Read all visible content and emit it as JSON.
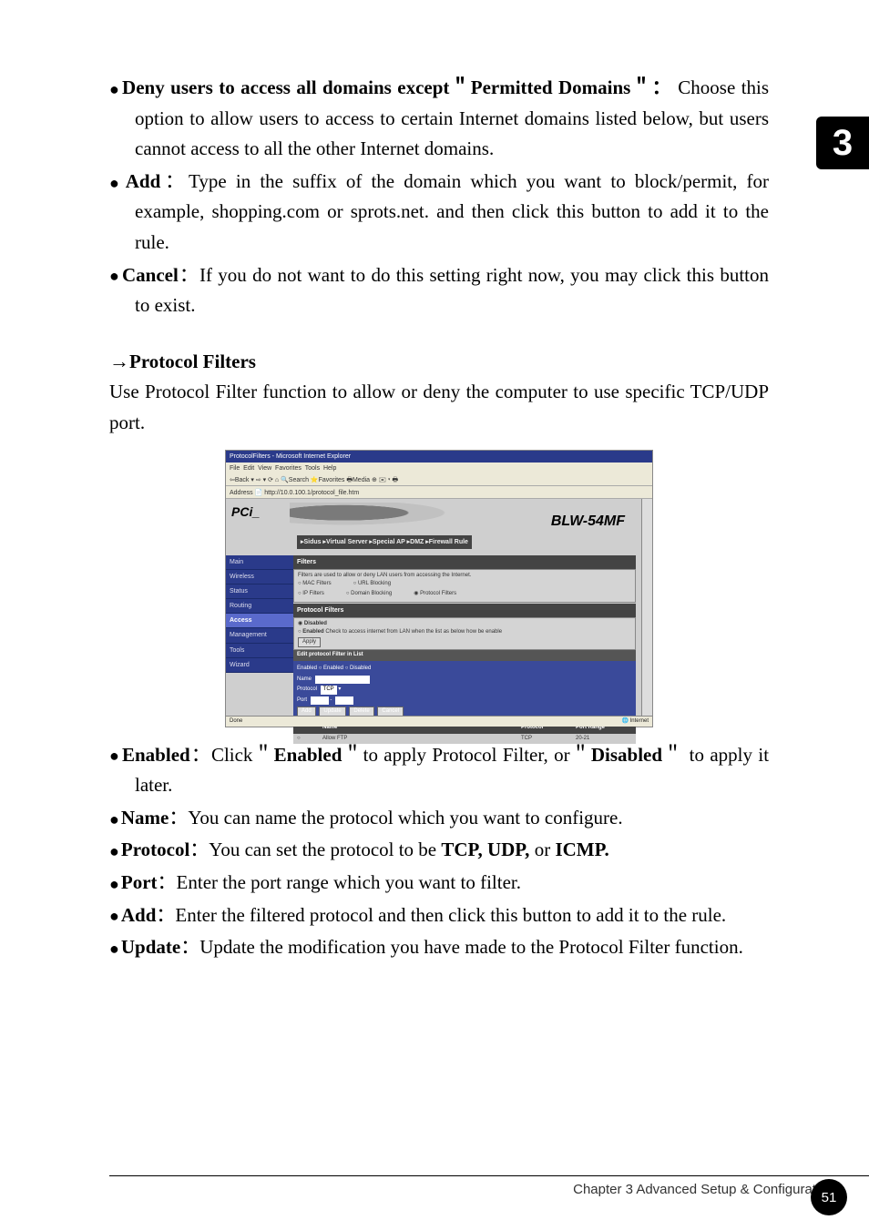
{
  "deny": {
    "label_pre": "Deny users to access all domains except",
    "label_quote": "Permitted Domains",
    "desc": "Choose this option to allow users to access to certain Internet domains listed below, but users cannot access to all the other Internet domains."
  },
  "add1": {
    "label": "Add",
    "desc": "Type in the suffix of the domain which you want to block/permit, for example, shopping.com or sprots.net. and then click this button to add it to the rule."
  },
  "cancel": {
    "label": "Cancel",
    "desc": "If you do not want to do this setting right now, you may click this button to exist."
  },
  "protocol_filters": {
    "title": "Protocol Filters",
    "desc": "Use Protocol Filter function to allow or deny the computer to use specific TCP/UDP port."
  },
  "screenshot": {
    "window_title": "ProtocolFilters - Microsoft Internet Explorer",
    "brand": "PCi_",
    "model": "BLW-54MF",
    "tabs": "▸Sidus  ▸Virtual Server  ▸Special AP  ▸DMZ  ▸Firewall Rule",
    "sidebar": [
      "Main",
      "Wireless",
      "Status",
      "Routing",
      "Access",
      "Management",
      "Tools",
      "Wizard"
    ],
    "filters": {
      "title": "Filters",
      "note": "Filters are used to allow or deny LAN users from accessing the Internet.",
      "opts": [
        "MAC Filters",
        "URL Blocking",
        "IP Filters",
        "Domain Blocking",
        "Protocol Filters"
      ]
    },
    "pf": {
      "title": "Protocol Filters",
      "disabled": "Disabled",
      "enabled": "Enabled",
      "note": "Check to access internet from LAN when the list as below how be enable",
      "apply": "Apply"
    },
    "edit": {
      "title": "Edit protocol Filter in List",
      "enabled_lbl": "Enabled",
      "enabled_opt": "Enabled",
      "disabled_opt": "Disabled",
      "name_lbl": "Name",
      "protocol_lbl": "Protocol",
      "protocol_val": "TCP",
      "port_lbl": "Port",
      "buttons": [
        "Add",
        "Update",
        "Delete",
        "Cancel"
      ]
    },
    "table": {
      "headers": [
        "Name",
        "Protocol",
        "Port Range"
      ],
      "row1": [
        "Allow FTP",
        "TCP",
        "20-21"
      ]
    },
    "status_right": "Internet"
  },
  "enabled": {
    "label": "Enabled",
    "desc_pre": "Click",
    "desc_quote1": "Enabled",
    "desc_mid": "to apply Protocol Filter, or",
    "desc_quote2": "Disabled",
    "desc_post": "to apply it later."
  },
  "name": {
    "label": "Name",
    "desc": "You can name the protocol which you want to configure."
  },
  "protocol": {
    "label": "Protocol",
    "desc_pre": "You can set the protocol to be",
    "desc_bold": "TCP, UDP,",
    "desc_mid": "or",
    "desc_bold2": "ICMP."
  },
  "port": {
    "label": "Port",
    "desc": "Enter the port range which you want to filter."
  },
  "add2": {
    "label": "Add",
    "desc": "Enter the filtered protocol and then click this button to add it to the rule."
  },
  "update": {
    "label": "Update",
    "desc": "Update the modification you have made to the Protocol Filter function."
  },
  "chapter_tab": "3",
  "footer": {
    "text": "Chapter 3 Advanced Setup & Configuration",
    "page": "51"
  }
}
